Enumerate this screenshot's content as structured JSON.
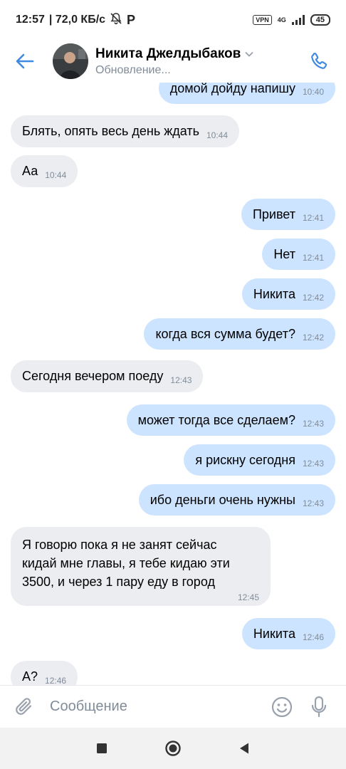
{
  "status_bar": {
    "time": "12:57",
    "speed": "| 72,0 КБ/с",
    "vpn": "VPN",
    "network": "4G",
    "battery": "45"
  },
  "header": {
    "name": "Никита Джелдыбаков",
    "status": "Обновление...",
    "accent_color": "#3f8ae0"
  },
  "messages": [
    {
      "dir": "out",
      "text": "домой дойду напишу",
      "time": "10:40"
    },
    {
      "dir": "in",
      "text": "Блять,  опять весь день ждать",
      "time": "10:44"
    },
    {
      "dir": "in",
      "text": "Аа",
      "time": "10:44"
    },
    {
      "dir": "out",
      "text": "Привет",
      "time": "12:41"
    },
    {
      "dir": "out",
      "text": "Нет",
      "time": "12:41"
    },
    {
      "dir": "out",
      "text": "Никита",
      "time": "12:42"
    },
    {
      "dir": "out",
      "text": "когда вся сумма будет?",
      "time": "12:42"
    },
    {
      "dir": "in",
      "text": "Сегодня вечером поеду",
      "time": "12:43"
    },
    {
      "dir": "out",
      "text": "может тогда все сделаем?",
      "time": "12:43"
    },
    {
      "dir": "out",
      "text": "я рискну сегодня",
      "time": "12:43"
    },
    {
      "dir": "out",
      "text": "ибо деньги очень нужны",
      "time": "12:43"
    },
    {
      "dir": "in",
      "text": "Я говорю пока я не занят сейчас\nкидай мне главы,   я тебе кидаю эти\n3500, и через 1 пару еду в город",
      "time": "12:45"
    },
    {
      "dir": "out",
      "text": "Никита",
      "time": "12:46"
    },
    {
      "dir": "in",
      "text": "А?",
      "time": "12:46"
    }
  ],
  "composer": {
    "placeholder": "Сообщение"
  },
  "colors": {
    "incoming_bubble": "#ebedf0",
    "outgoing_bubble": "#cce4ff",
    "timestamp": "#818c99"
  }
}
